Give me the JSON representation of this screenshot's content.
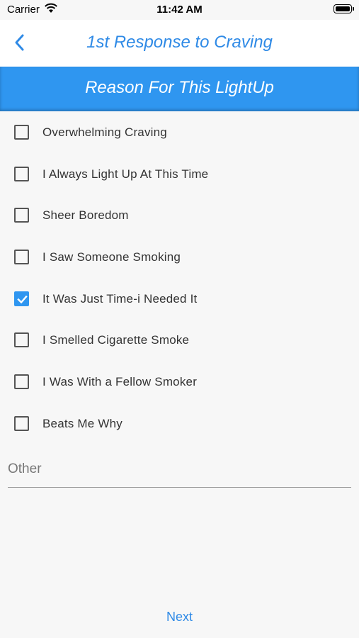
{
  "status_bar": {
    "carrier": "Carrier",
    "time": "11:42 AM"
  },
  "nav": {
    "title": "1st Response to Craving",
    "back_icon": "chevron-left-icon"
  },
  "banner": {
    "title": "Reason For This LightUp"
  },
  "reasons": [
    {
      "label": "Overwhelming Craving",
      "checked": false
    },
    {
      "label": "I Always Light Up At This Time",
      "checked": false
    },
    {
      "label": "Sheer Boredom",
      "checked": false
    },
    {
      "label": "I Saw Someone Smoking",
      "checked": false
    },
    {
      "label": "It Was Just Time-i Needed It",
      "checked": true
    },
    {
      "label": "I Smelled Cigarette Smoke",
      "checked": false
    },
    {
      "label": "I Was With a Fellow Smoker",
      "checked": false
    },
    {
      "label": "Beats Me Why",
      "checked": false
    }
  ],
  "other": {
    "placeholder": "Other",
    "value": ""
  },
  "footer": {
    "next_label": "Next"
  },
  "colors": {
    "accent": "#2f96f0",
    "title_blue": "#2f8ae6",
    "background": "#f7f7f7"
  }
}
